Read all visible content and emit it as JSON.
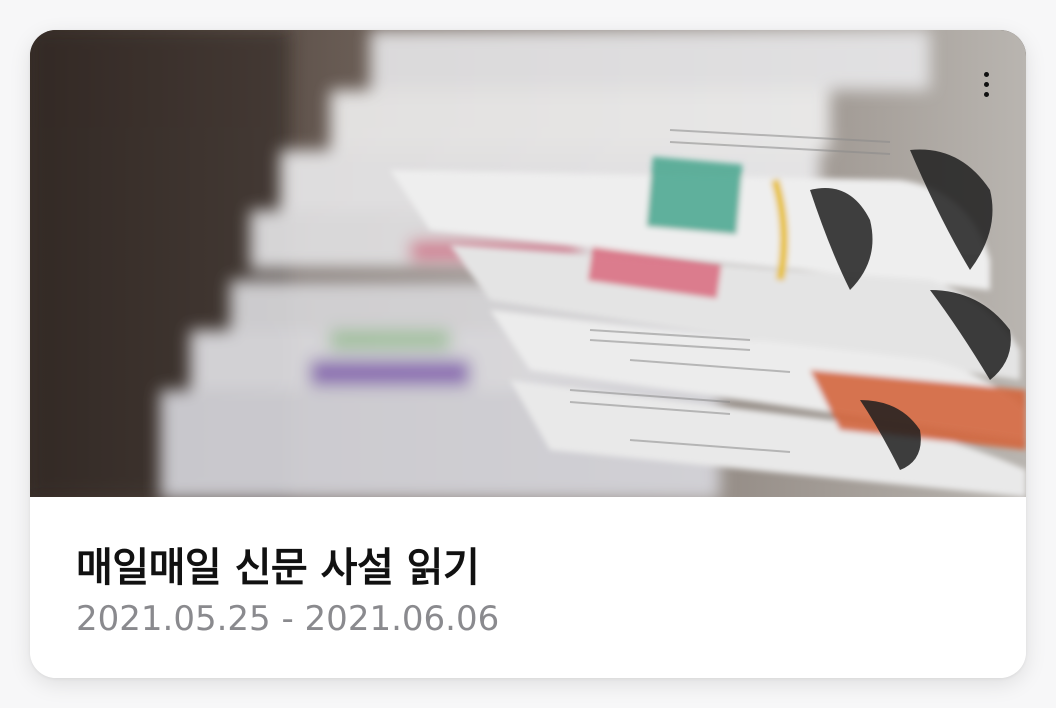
{
  "card": {
    "title": "매일매일 신문 사설 읽기",
    "period": "2021.05.25 - 2021.06.06",
    "image_icon": "newspaper-stack-image",
    "menu_icon": "more-vertical-icon"
  },
  "colors": {
    "title_text": "#111111",
    "period_text": "#8a8a8e",
    "card_background": "#ffffff",
    "page_background": "#f7f7f8"
  }
}
